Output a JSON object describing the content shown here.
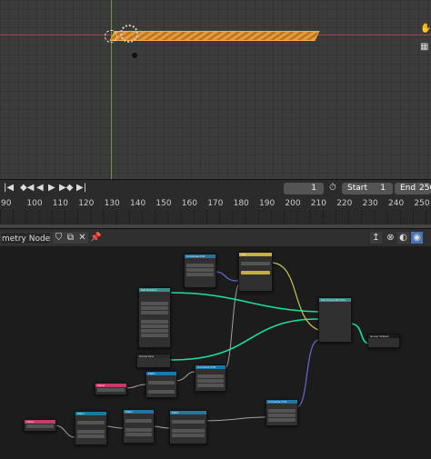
{
  "timeline": {
    "current_frame": "1",
    "start_label": "Start",
    "start_value": "1",
    "end_label": "End",
    "end_value": "250",
    "ruler_ticks": [
      "90",
      "100",
      "110",
      "120",
      "130",
      "140",
      "150",
      "160",
      "170",
      "180",
      "190",
      "200",
      "210",
      "220",
      "230",
      "240",
      "250"
    ]
  },
  "node_editor": {
    "tree_name": "metry Nodes",
    "nodes": [
      {
        "title": "Set Position",
        "header_color": "#3a8c8b"
      },
      {
        "title": "Curve Line",
        "header_color": "#3a8c8b"
      },
      {
        "title": "Set Curve Normal",
        "header_color": "#3a8c8b"
      },
      {
        "title": "Grid",
        "header_color": "#3a8c8b"
      },
      {
        "title": "Mix",
        "header_color": "#c3b13b"
      },
      {
        "title": "Combine XYZ",
        "header_color": "#1e78a6"
      },
      {
        "title": "Combine XYZ",
        "header_color": "#1e78a6"
      },
      {
        "title": "Combine XYZ",
        "header_color": "#1e78a6"
      },
      {
        "title": "Math",
        "header_color": "#1e78a6"
      },
      {
        "title": "Math",
        "header_color": "#1e78a6"
      },
      {
        "title": "Math",
        "header_color": "#1e78a6"
      },
      {
        "title": "Math",
        "header_color": "#1e78a6"
      },
      {
        "title": "Value",
        "header_color": "#c53a6b"
      },
      {
        "title": "Value",
        "header_color": "#c53a6b"
      },
      {
        "title": "Group Input",
        "header_color": "#1a1a1a"
      },
      {
        "title": "Group Output",
        "header_color": "#1a1a1a"
      }
    ]
  },
  "colors": {
    "viewport_bg": "#3c3c3c",
    "x_axis": "#a3434a",
    "y_axis": "#6c9a2b",
    "selection_orange": "#ffae3f",
    "geometry_link": "#19e0a0",
    "vector_link": "#6363c7",
    "float_link": "#a1a1a1",
    "value_link": "#c8c64e"
  }
}
